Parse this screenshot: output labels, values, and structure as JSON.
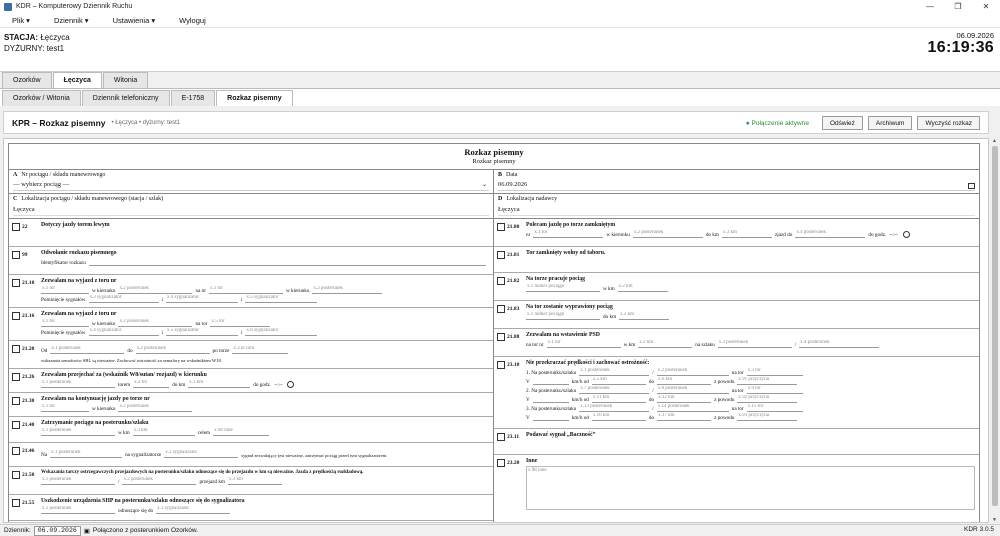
{
  "window": {
    "title": "KDR – Komputerowy Dziennik Ruchu"
  },
  "menu": [
    "Plik",
    "Dziennik",
    "Ustawienia",
    "Wyloguj"
  ],
  "header": {
    "station_label": "STACJA:",
    "station_value": "Łęczyca",
    "duty_label": "DYŻURNY:",
    "duty_value": "test1",
    "date": "06.09.2026",
    "time": "16:19:36"
  },
  "tabs_top": [
    "Ozorków",
    "Łęczyca",
    "Witonia"
  ],
  "tabs_sub": [
    "Ozorków / Witonia",
    "Dziennik telefoniczny",
    "E-1758",
    "Rozkaz pisemny"
  ],
  "card": {
    "title": "KPR – Rozkaz pisemny",
    "subtitle": "• Łęczyca • dyżurny: test1",
    "connection": "● Połączenie aktywne",
    "btn_refresh": "Odśwież",
    "btn_archive": "Archiwum",
    "btn_clear": "Wyczyść rozkaz"
  },
  "form": {
    "title": "Rozkaz pisemny",
    "subtitle": "Rozkaz pisemny",
    "A_code": "A",
    "A_label": "Nr pociągu / składu manewrowego",
    "A_value": "— wybierz pociąg —",
    "B_code": "B",
    "B_label": "Data",
    "B_value": "06.09.2026",
    "C_code": "C",
    "C_label": "Lokalizacja pociągu / składu manewrowego (stacja / szlak)",
    "C_value": "Łęczyca",
    "D_code": "D",
    "D_label": "Lokalizacja nadawcy",
    "D_value": "Łęczyca"
  },
  "left": {
    "i22": {
      "code": "22",
      "title": "Dotyczy jazdy torem lewym"
    },
    "i99": {
      "code": "99",
      "title": "Odwołanie rozkazu pisemnego",
      "l1": "Identyfikator rozkazu"
    },
    "i2110": {
      "code": "21.10",
      "title": "Zezwalam na wyjazd z toru nr",
      "f1": "x.1 tor",
      "t1": "w kierunku",
      "f2": "x.2 posterunek",
      "t2": "na nr",
      "f3": "x.1 tor",
      "t3": "w kierunku",
      "f4": "x.2 posterunek",
      "t4": "Pominięcie sygnałów",
      "f5": "x.3 sygnalizator",
      "t5": "i",
      "f6": "x.4 sygnalizator",
      "t6": "i",
      "f7": "x.5 sygnalizator"
    },
    "i2116": {
      "code": "21.16",
      "title": "Zezwalam na wyjazd z toru nr",
      "f1": "x.1 tor",
      "t1": "w kierunku",
      "f2": "x.2 posterunek",
      "t2": "na tor",
      "f3": "x.5 tor",
      "t4": "Pominięcie sygnałów",
      "f5": "x.4 sygnalizator",
      "t5": "i",
      "f6": "x.5 sygnalizator",
      "t6": "i",
      "f7": "x.6 sygnalizator"
    },
    "i2120": {
      "code": "21.20",
      "t0": "Od",
      "f1": "x.1 posterunek",
      "t1": "do",
      "f2": "x.2 posterunek",
      "t2": "po torze",
      "f3": "x.3 nr toru",
      "note": "wskazania semaforów SBL są nieważne. Zachować ostrożność za semafory na wskaźnikiem W18."
    },
    "i2126": {
      "code": "21.26",
      "title": "Zezwalam przejechać za (wskaźnik W8/sutan/ rozjazd) w kierunku",
      "f1": "x.1 posterunek",
      "t1": "torem",
      "f2": "x.2 tor",
      "t2": "do km",
      "f3": "x.3 km",
      "t3": "do godz.",
      "time": "--:--"
    },
    "i2130": {
      "code": "21.30",
      "title": "Zezwalam na kontynuację jazdy po torze nr",
      "f1": "x.1 tor",
      "t1": "w kierunku",
      "f2": "x.2 posterunek"
    },
    "i2140": {
      "code": "21.40",
      "title": "Zatrzymanie pociągu na posterunku/szlaku",
      "f1": "x.1 posterunek",
      "t1": "w km",
      "f2": "x.3 km",
      "t2": "celem",
      "f3": "x.98 inne"
    },
    "i2146": {
      "code": "21.46",
      "t0": "Na",
      "f1": "x.1 posterunek",
      "t1": "na sygnalizatorze",
      "f2": "x.2 sygnalizator",
      "t2": "sygnał zezwalający jest nieważny, zatrzymać pociąg przed tym sygnalizatorem."
    },
    "i2150": {
      "code": "21.50",
      "title": "Wskazania tarczy ostrzegawczych przejazdowych na posterunku/szlaku odnoszące się do przejazdu w km są nieważne. Jazda z prędkością rozkładową.",
      "f1": "x.1 posterunek",
      "t1": "/",
      "f2": "x.2 posterunek",
      "t2": "przejazd km",
      "f3": "x.3 km"
    },
    "i2155": {
      "code": "21.55",
      "title": "Uszkodzenie urządzenia SHP na posterunku/szlaku odnoszące się do sygnalizatora",
      "f1": "x.1 posterunek",
      "t1": "odnoszące się do",
      "f2": "x.3 sygnalizator"
    }
  },
  "right": {
    "i2180": {
      "code": "21.80",
      "title": "Polecam jazdę po torze zamkniętym",
      "t0": "nr",
      "f1": "x.1 tor",
      "t1": "w kierunku",
      "f2": "x.2 posterunek",
      "t2": "do km",
      "f3": "x.3 km",
      "t3": "zjazd do",
      "f4": "x.4 posterunek",
      "t4": "do godz.",
      "time": "--:--"
    },
    "i2181": {
      "code": "21.81",
      "title": "Tor zamknięty wolny od taboru."
    },
    "i2182": {
      "code": "21.82",
      "title": "Na torze pracuje pociąg",
      "f1": "x.1 numer pociągu",
      "t1": "w km",
      "f2": "x.2 km"
    },
    "i2183": {
      "code": "21.83",
      "title": "Na tor zostanie wyprawiony pociąg",
      "f1": "x.1 numer pociągu",
      "t1": "do km",
      "f2": "x.2 km"
    },
    "i2188": {
      "code": "21.88",
      "title": "Zezwalam na wstawienie PSD",
      "t0": "na tor nr",
      "f1": "x.1 tor",
      "t1": "w km",
      "f2": "x.2 km",
      "t2": "na szlaku",
      "f3": "x.3 posterunek",
      "t3": "/",
      "f4": "x.4 posterunek"
    },
    "i2310": {
      "code": "23.10",
      "title": "Nie przekraczać prędkości i zachować ostrożność:",
      "r1": {
        "a": "1. Na posterunku/szlaku",
        "b": "x.1 posterunek",
        "c": "/",
        "d": "x.2 posterunek",
        "e": "na tor",
        "f": "x.3 tor"
      },
      "r2": {
        "a": "V",
        "b": "km/h od",
        "c": "x.5 km",
        "d": "do",
        "e": "x.6 km",
        "f": "z powodu",
        "g": "x.91 przyczyna"
      },
      "r3": {
        "a": "2. Na posterunku/szlaku",
        "b": "x.7 posterunek",
        "c": "/",
        "d": "x.8 posterunek",
        "e": "na tor",
        "f": "x.9 tor"
      },
      "r4": {
        "a": "V",
        "b": "km/h od",
        "c": "x.11 km",
        "d": "do",
        "e": "x.12 km",
        "f": "z powodu",
        "g": "x.92 przyczyna"
      },
      "r5": {
        "a": "3. Na posterunku/szlaku",
        "b": "x.13 posterunek",
        "c": "/",
        "d": "x.14 posterunek",
        "e": "na tor",
        "f": "x.15 tor"
      },
      "r6": {
        "a": "V",
        "b": "km/h od",
        "c": "x.16 km",
        "d": "do",
        "e": "x.17 km",
        "f": "z powodu",
        "g": "x.93 przyczyna"
      }
    },
    "i2311": {
      "code": "23.11",
      "title": "Podawać sygnał „Baczność”"
    },
    "i2320": {
      "code": "23.20",
      "title": "Inne",
      "placeholder": "x.98 inne"
    }
  },
  "status": {
    "label": "Dziennik:",
    "date": "06.09.2026",
    "conn": "Połączono z posterunkiem Ozorków.",
    "version": "KDR 3.0.5"
  }
}
